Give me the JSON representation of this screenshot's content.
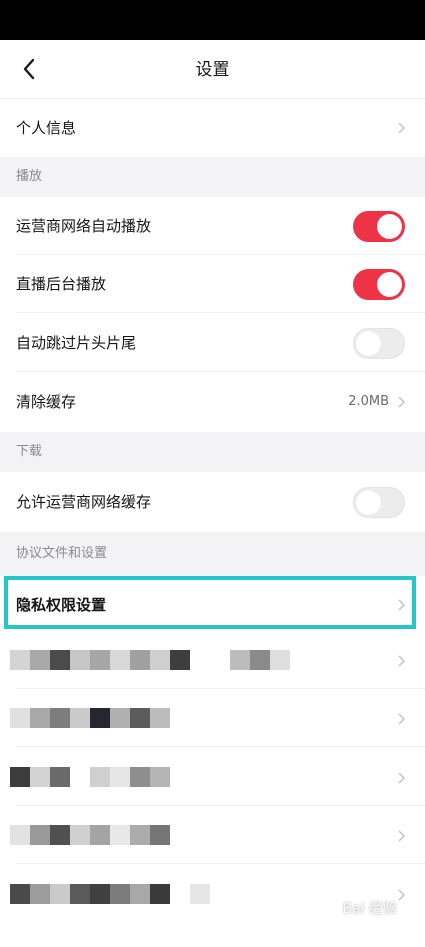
{
  "header": {
    "title": "设置"
  },
  "rows": {
    "profile": "个人信息",
    "cellular_autoplay": "运营商网络自动播放",
    "live_background": "直播后台播放",
    "skip_intro": "自动跳过片头片尾",
    "clear_cache": "清除缓存",
    "cache_size": "2.0MB",
    "allow_cellular_cache": "允许运营商网络缓存",
    "privacy": "隐私权限设置"
  },
  "sections": {
    "playback": "播放",
    "download": "下载",
    "agreements": "协议文件和设置"
  },
  "toggles": {
    "cellular_autoplay": true,
    "live_background": true,
    "skip_intro": false,
    "allow_cellular_cache": false
  },
  "colors": {
    "toggle_on": "#ee3347",
    "highlight": "#24c6c8",
    "section_bg": "#f3f3f5"
  },
  "watermark": "Bai 经验"
}
